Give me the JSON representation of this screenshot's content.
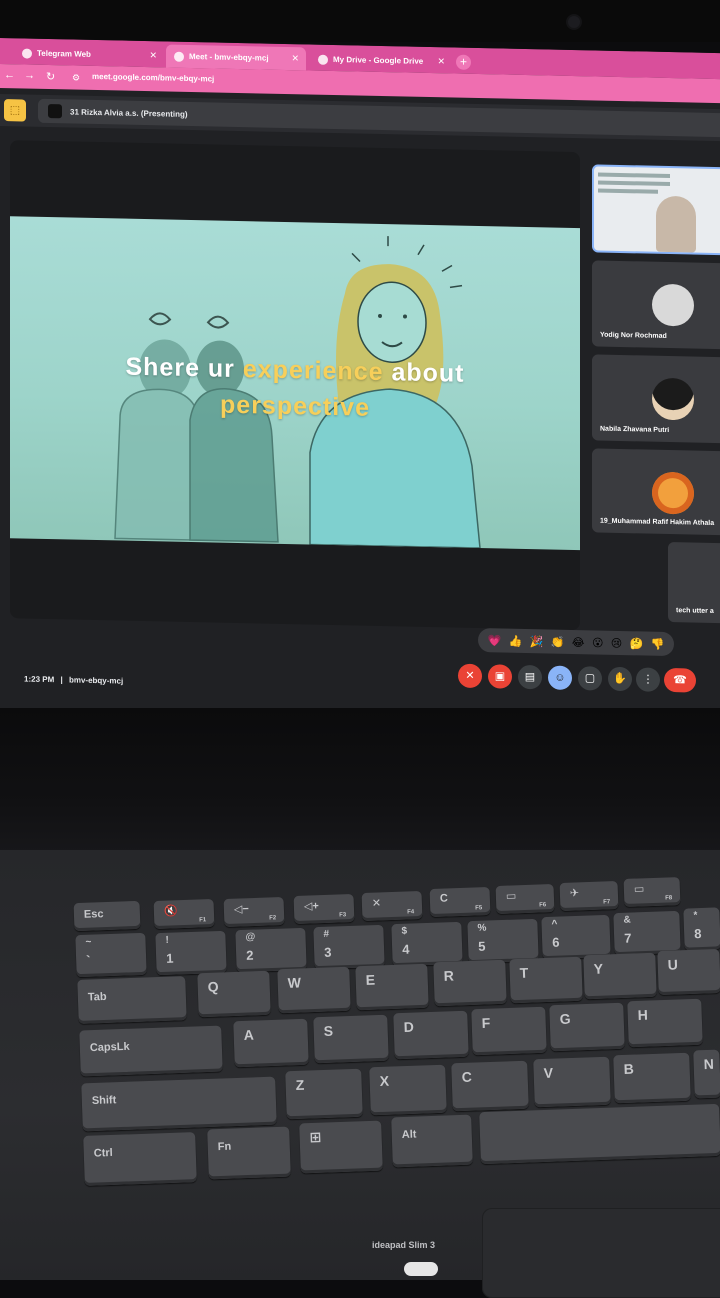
{
  "browser": {
    "tabs": [
      {
        "label": "Telegram Web"
      },
      {
        "label": "Meet - bmv-ebqy-mcj"
      },
      {
        "label": "My Drive - Google Drive"
      }
    ],
    "new_tab": "+",
    "url": "meet.google.com/bmv-ebqy-mcj"
  },
  "meet": {
    "presenting_label": "31 Rizka Alvia a.s. (Presenting)",
    "slide": {
      "w1": "Shere ur ",
      "y1": "experience",
      "w2": " about",
      "y2": "perspective"
    },
    "participants": [
      {
        "name": ""
      },
      {
        "name": "Yodig Nor Rochmad"
      },
      {
        "name": "Nabila Zhavana Putri"
      },
      {
        "name": "19_Muhammad Rafif Hakim Athala"
      },
      {
        "name": "tech utter a"
      }
    ],
    "reactions": [
      "💗",
      "👍",
      "🎉",
      "👏",
      "😂",
      "😮",
      "😢",
      "🤔",
      "👎"
    ],
    "time": "1:23 PM",
    "separator": "|",
    "meeting_code": "bmv-ebqy-mcj"
  },
  "keyboard": {
    "row_fn": [
      {
        "main": "Esc",
        "fn": ""
      },
      {
        "main": "🔇",
        "fn": "F1"
      },
      {
        "main": "◁−",
        "fn": "F2"
      },
      {
        "main": "◁+",
        "fn": "F3"
      },
      {
        "main": "✕",
        "fn": "F4"
      },
      {
        "main": "C",
        "fn": "F5"
      },
      {
        "main": "▭",
        "fn": "F6"
      },
      {
        "main": "✈",
        "fn": "F7"
      },
      {
        "main": "▭",
        "fn": "F8"
      }
    ],
    "row_num": [
      {
        "top": "~",
        "bot": "`"
      },
      {
        "top": "!",
        "bot": "1"
      },
      {
        "top": "@",
        "bot": "2"
      },
      {
        "top": "#",
        "bot": "3"
      },
      {
        "top": "$",
        "bot": "4"
      },
      {
        "top": "%",
        "bot": "5"
      },
      {
        "top": "^",
        "bot": "6"
      },
      {
        "top": "&",
        "bot": "7"
      },
      {
        "top": "*",
        "bot": "8"
      }
    ],
    "row_q": [
      "Tab",
      "Q",
      "W",
      "E",
      "R",
      "T",
      "Y",
      "U"
    ],
    "row_a": [
      "CapsLk",
      "A",
      "S",
      "D",
      "F",
      "G",
      "H"
    ],
    "row_z": [
      "Shift",
      "Z",
      "X",
      "C",
      "V",
      "B",
      "N"
    ],
    "row_ctrl": [
      "Ctrl",
      "Fn",
      "⊞",
      "Alt"
    ],
    "brand": "ideapad Slim 3"
  }
}
